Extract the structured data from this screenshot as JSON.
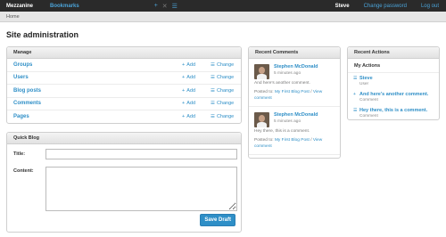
{
  "topbar": {
    "brand": "Mezzanine",
    "bookmarks": "Bookmarks",
    "icons": [
      "plus-icon",
      "close-icon",
      "menu-icon"
    ],
    "user": "Steve",
    "change_password": "Change password",
    "logout": "Log out"
  },
  "breadcrumb": "Home",
  "page_title": "Site administration",
  "manage": {
    "title": "Manage",
    "add_label": "Add",
    "change_label": "Change",
    "rows": [
      {
        "name": "Groups"
      },
      {
        "name": "Users"
      },
      {
        "name": "Blog posts"
      },
      {
        "name": "Comments"
      },
      {
        "name": "Pages"
      }
    ]
  },
  "quick_blog": {
    "title": "Quick Blog",
    "title_label": "Title:",
    "content_label": "Content:",
    "title_value": "",
    "content_value": "",
    "save_label": "Save Draft"
  },
  "recent_comments": {
    "title": "Recent Comments",
    "items": [
      {
        "author": "Stephen McDonald",
        "time": "5 minutes ago",
        "body": "And here's another comment.",
        "posted_prefix": "Posted to: ",
        "post_link": "My First Blog Post",
        "separator": " / ",
        "view_link": "View comment"
      },
      {
        "author": "Stephen McDonald",
        "time": "5 minutes ago",
        "body": "Hey there, this is a comment.",
        "posted_prefix": "Posted to: ",
        "post_link": "My First Blog Post",
        "separator": " / ",
        "view_link": "View comment"
      }
    ]
  },
  "recent_actions": {
    "title": "Recent Actions",
    "subtitle": "My Actions",
    "items": [
      {
        "icon": "edit-icon",
        "glyph": "☰",
        "title": "Steve",
        "kind": "User"
      },
      {
        "icon": "add-icon",
        "glyph": "+",
        "title": "And here's another comment.",
        "kind": "Comment"
      },
      {
        "icon": "edit-icon",
        "glyph": "☰",
        "title": "Hey there, this is a comment.",
        "kind": "Comment"
      }
    ]
  },
  "colors": {
    "accent": "#2f8fc7",
    "topbar": "#2a2a2a"
  }
}
